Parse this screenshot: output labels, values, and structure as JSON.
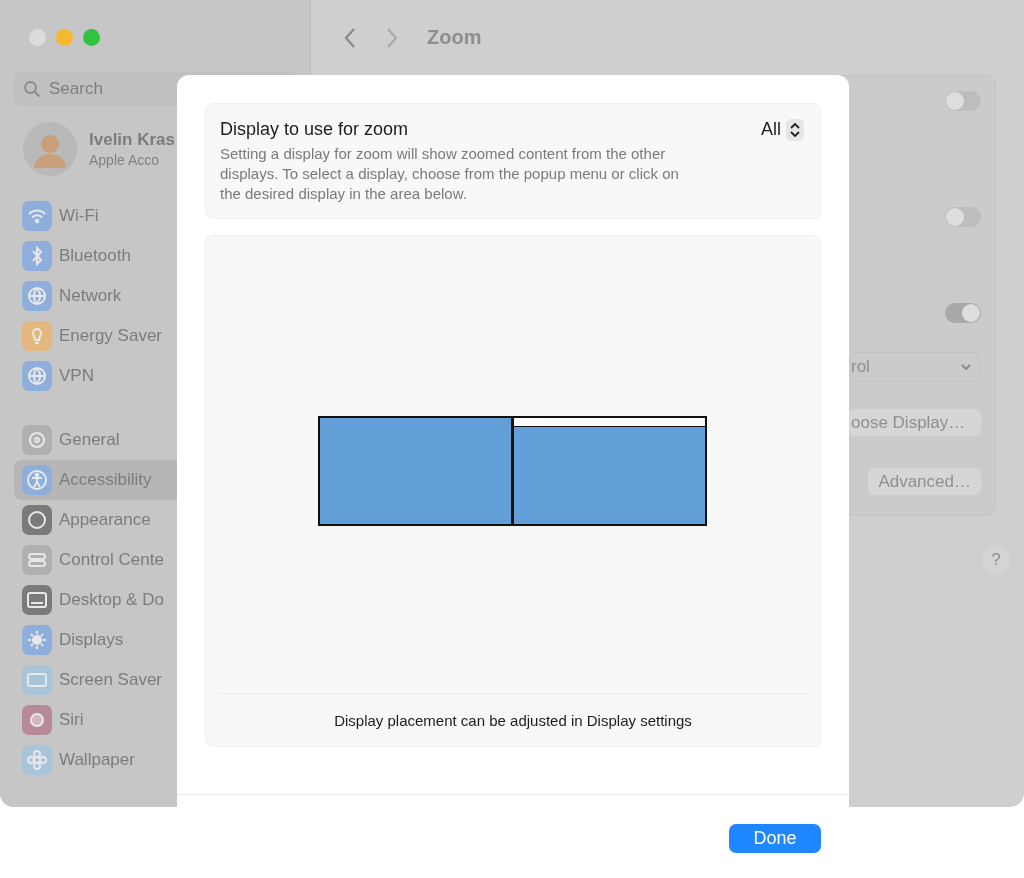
{
  "window": {
    "title": "Zoom",
    "traffic_lights": [
      {
        "color": "#dcdcdc"
      },
      {
        "color": "#f5b82e"
      },
      {
        "color": "#2fc440"
      }
    ]
  },
  "sidebar": {
    "search": {
      "placeholder": "Search"
    },
    "account": {
      "name": "Ivelin Kras",
      "subtitle": "Apple Acco"
    },
    "groups": [
      [
        {
          "label": "Wi-Fi",
          "kind": "wifi",
          "selected": false
        },
        {
          "label": "Bluetooth",
          "kind": "bluetooth",
          "selected": false
        },
        {
          "label": "Network",
          "kind": "network",
          "selected": false
        },
        {
          "label": "Energy Saver",
          "kind": "energy",
          "selected": false
        },
        {
          "label": "VPN",
          "kind": "vpn",
          "selected": false
        }
      ],
      [
        {
          "label": "General",
          "kind": "general",
          "selected": false
        },
        {
          "label": "Accessibility",
          "kind": "accessibility",
          "selected": true
        },
        {
          "label": "Appearance",
          "kind": "appearance",
          "selected": false
        },
        {
          "label": "Control Cente",
          "kind": "control",
          "selected": false
        },
        {
          "label": "Desktop & Do",
          "kind": "desktop",
          "selected": false
        },
        {
          "label": "Displays",
          "kind": "displays",
          "selected": false
        },
        {
          "label": "Screen Saver",
          "kind": "screensaver",
          "selected": false
        },
        {
          "label": "Siri",
          "kind": "siri",
          "selected": false
        },
        {
          "label": "Wallpaper",
          "kind": "wallpaper",
          "selected": false
        }
      ]
    ]
  },
  "settings": {
    "toggles": [
      {
        "on": false
      },
      {
        "on": false
      },
      {
        "on": true
      }
    ],
    "popup": {
      "value": "rol"
    },
    "buttons": [
      "oose Display…",
      "Advanced…"
    ],
    "help": "?"
  },
  "sheet": {
    "display_setting": {
      "title": "Display to use for zoom",
      "description": "Setting a display for zoom will show zoomed content from the other displays. To select a display, choose from the popup menu or click on the desired display in the area below.",
      "value": "All"
    },
    "displays": [
      {
        "menu_bar": false
      },
      {
        "menu_bar": true
      }
    ],
    "caption": "Display placement can be adjusted in Display settings",
    "done": "Done"
  }
}
